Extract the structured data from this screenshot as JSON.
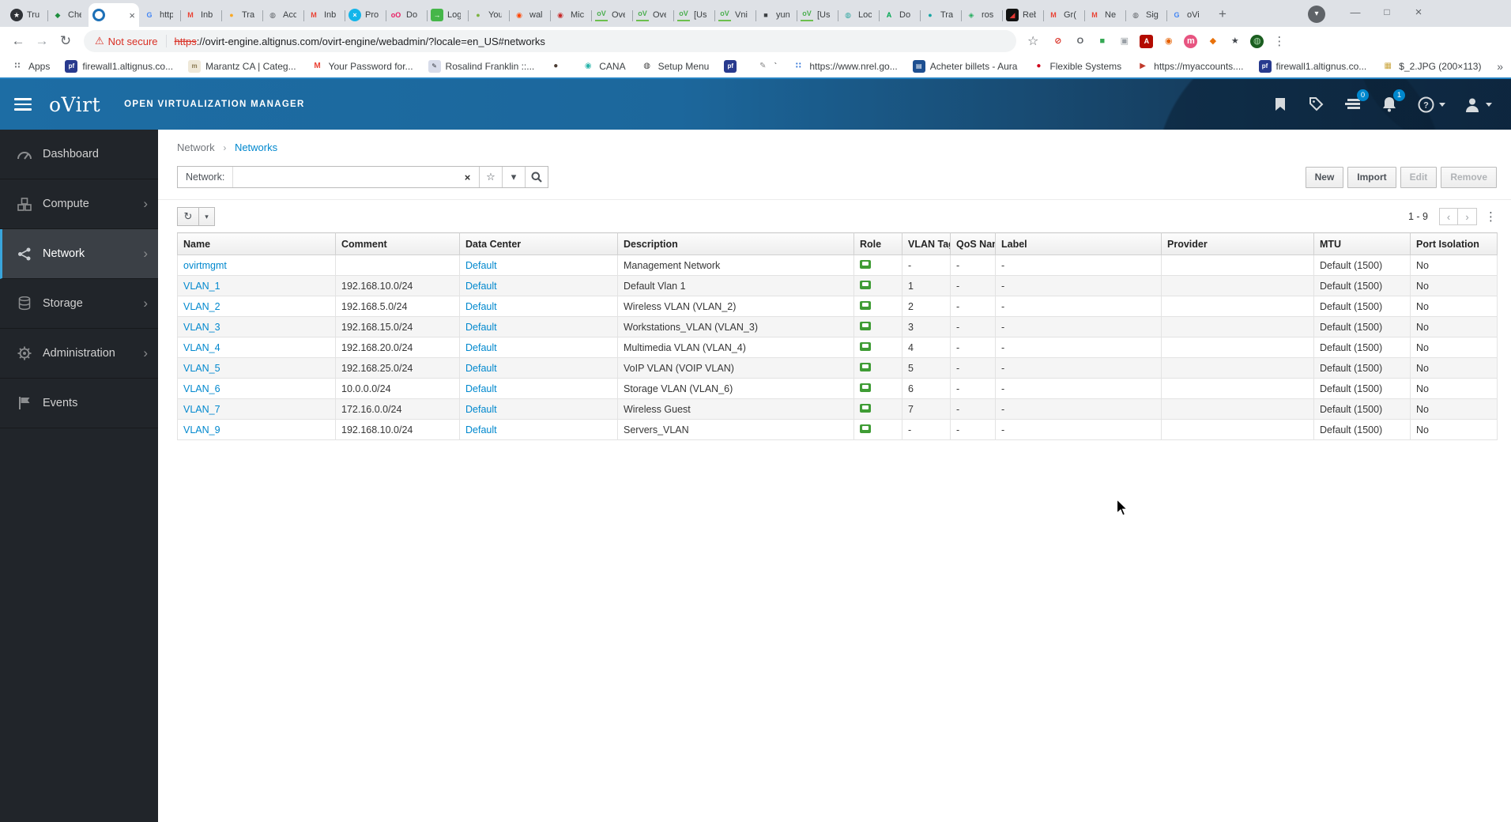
{
  "browser": {
    "tabs": [
      {
        "label": "Tru",
        "g": "★",
        "bg": "#2f3237",
        "fg": "#ffffff",
        "cls": "",
        "state": "",
        "close": ""
      },
      {
        "label": "Che",
        "g": "◆",
        "fg": "#1e8e3e",
        "cls": "",
        "state": "",
        "close": ""
      },
      {
        "label": "",
        "g": "",
        "cls": "ring",
        "state": "active",
        "close": "×"
      },
      {
        "label": "http",
        "g": "G",
        "fg": "#4285f4",
        "state": "",
        "close": ""
      },
      {
        "label": "Inb",
        "g": "M",
        "fg": "#ea4335",
        "state": "",
        "close": ""
      },
      {
        "label": "Tra",
        "g": "●",
        "fg": "#f9a825",
        "state": "",
        "close": ""
      },
      {
        "label": "Acc",
        "g": "◍",
        "fg": "#5f6368",
        "state": "",
        "close": ""
      },
      {
        "label": "Inb",
        "g": "M",
        "fg": "#ea4335",
        "state": "",
        "close": ""
      },
      {
        "label": "Pro",
        "g": "×",
        "bg": "#13b5ea",
        "fg": "#ffffff",
        "state": "",
        "close": ""
      },
      {
        "label": "Do",
        "g": "oO",
        "fg": "#e91e63",
        "state": "",
        "close": ""
      },
      {
        "label": "Log",
        "g": "→",
        "bg": "#45b649",
        "fg": "#ffffff",
        "cls": "sq",
        "state": "",
        "close": ""
      },
      {
        "label": "You",
        "g": "●",
        "fg": "#7cb342",
        "state": "",
        "close": ""
      },
      {
        "label": "wal",
        "g": "◉",
        "fg": "#ff4500",
        "state": "",
        "close": ""
      },
      {
        "label": "Mic",
        "g": "◉",
        "fg": "#c62828",
        "state": "",
        "close": ""
      },
      {
        "label": "Ove",
        "g": "oV",
        "cls": "ul",
        "fg": "#4caf50",
        "state": "",
        "close": ""
      },
      {
        "label": "Ove",
        "g": "oV",
        "cls": "ul",
        "fg": "#4caf50",
        "state": "",
        "close": ""
      },
      {
        "label": "[Us",
        "g": "oV",
        "cls": "ul",
        "fg": "#4caf50",
        "state": "",
        "close": ""
      },
      {
        "label": "Vni",
        "g": "oV",
        "cls": "ul",
        "fg": "#4caf50",
        "state": "",
        "close": ""
      },
      {
        "label": "yun",
        "g": "■",
        "fg": "#3c4043",
        "state": "",
        "close": ""
      },
      {
        "label": "[Us",
        "g": "oV",
        "cls": "ul",
        "fg": "#4caf50",
        "state": "",
        "close": ""
      },
      {
        "label": "Loc",
        "g": "◍",
        "fg": "#2fa7a0",
        "state": "",
        "close": ""
      },
      {
        "label": "Do",
        "g": "A",
        "fg": "#00a651",
        "state": "",
        "close": ""
      },
      {
        "label": "Tra",
        "g": "●",
        "fg": "#16a5a3",
        "state": "",
        "close": ""
      },
      {
        "label": "ros",
        "g": "◈",
        "fg": "#27ae60",
        "state": "",
        "close": ""
      },
      {
        "label": "Reb",
        "g": "◢",
        "bg": "#111111",
        "fg": "#e53935",
        "cls": "sq",
        "state": "",
        "close": ""
      },
      {
        "label": "Gr(",
        "g": "M",
        "fg": "#ea4335",
        "state": "",
        "close": ""
      },
      {
        "label": "Ne",
        "g": "M",
        "fg": "#ea4335",
        "state": "",
        "close": ""
      },
      {
        "label": "Sig",
        "g": "◍",
        "fg": "#5f6368",
        "state": "",
        "close": ""
      },
      {
        "label": "oVi",
        "g": "G",
        "fg": "#4285f4",
        "state": "",
        "close": ""
      }
    ],
    "new_tab_glyph": "+",
    "tab_search_glyph": "▾",
    "window_controls": {
      "minimize": "—",
      "maximize": "□",
      "close": "×"
    },
    "nav": {
      "back": "←",
      "forward": "→",
      "reload": "↻"
    },
    "address": {
      "warning_icon": "⚠",
      "warning_text": "Not secure",
      "scheme": "https",
      "rest": "://ovirt-engine.altignus.com/ovirt-engine/webadmin/?locale=en_US#networks"
    },
    "star_glyph": "☆",
    "menu_glyph": "⋮",
    "extensions": [
      {
        "g": "⊘",
        "fg": "#d93025"
      },
      {
        "g": "O",
        "fg": "#5f6368"
      },
      {
        "g": "■",
        "fg": "#34a853"
      },
      {
        "g": "▣",
        "fg": "#9aa0a6"
      },
      {
        "g": "A",
        "bg": "#b30b00",
        "fg": "#ffffff",
        "cls": "sq"
      },
      {
        "g": "◉",
        "fg": "#e66000"
      },
      {
        "g": "m",
        "bg": "#e75480",
        "fg": "#ffffff"
      },
      {
        "g": "◆",
        "fg": "#e8710a"
      },
      {
        "g": "★",
        "fg": "#41464c"
      },
      {
        "g": "◍",
        "bg": "#1b5e20",
        "fg": "#a5d6a7"
      }
    ],
    "bookmarks": [
      {
        "g": "∷",
        "fg": "#5f6368",
        "label": "Apps"
      },
      {
        "g": "pf",
        "bg": "#283a8e",
        "fg": "#ffffff",
        "cls": "sq",
        "label": "firewall1.altignus.co..."
      },
      {
        "g": "m",
        "bg": "#efe8d8",
        "fg": "#8a7a52",
        "cls": "sq",
        "label": "Marantz CA | Categ..."
      },
      {
        "g": "M",
        "fg": "#ea4335",
        "label": "Your Password for..."
      },
      {
        "g": "✎",
        "bg": "#d8dcea",
        "fg": "#30343b",
        "cls": "sq",
        "label": "Rosalind Franklin ::..."
      },
      {
        "g": "●",
        "fg": "#4a3b32",
        "label": ""
      },
      {
        "g": "◉",
        "fg": "#2ab5ab",
        "label": "CANA"
      },
      {
        "g": "◍",
        "fg": "#444444",
        "label": "Setup Menu"
      },
      {
        "g": "pf",
        "bg": "#283a8e",
        "fg": "#ffffff",
        "cls": "sq",
        "label": ""
      },
      {
        "g": "✎",
        "fg": "#888888",
        "label": "`"
      },
      {
        "g": "∷",
        "fg": "#2a6fd6",
        "label": "https://www.nrel.go..."
      },
      {
        "g": "▤",
        "bg": "#1d4f91",
        "fg": "#ffffff",
        "cls": "sq",
        "label": "Acheter billets - Aura"
      },
      {
        "g": "●",
        "fg": "#d0021b",
        "label": "Flexible Systems"
      },
      {
        "g": "▶",
        "fg": "#c0392b",
        "label": "https://myaccounts...."
      },
      {
        "g": "pf",
        "bg": "#283a8e",
        "fg": "#ffffff",
        "cls": "sq",
        "label": "firewall1.altignus.co..."
      },
      {
        "g": "▦",
        "fg": "#caa53d",
        "label": "$_2.JPG (200×113)"
      }
    ],
    "bookmarks_overflow_glyph": "»"
  },
  "masthead": {
    "brand": "oVirt",
    "product": "OPEN VIRTUALIZATION MANAGER",
    "tasks_badge": "0",
    "alerts_badge": "1"
  },
  "sidebar": {
    "items": [
      {
        "label": "Dashboard"
      },
      {
        "label": "Compute"
      },
      {
        "label": "Network"
      },
      {
        "label": "Storage"
      },
      {
        "label": "Administration"
      },
      {
        "label": "Events"
      }
    ]
  },
  "page": {
    "breadcrumb": {
      "section": "Network",
      "sep": "›",
      "current": "Networks"
    },
    "filter": {
      "label": "Network:",
      "value": "",
      "placeholder": "",
      "clear_glyph": "×",
      "star_glyph": "☆",
      "caret_glyph": "▾"
    },
    "actions": [
      {
        "label": "New",
        "state": ""
      },
      {
        "label": "Import",
        "state": ""
      },
      {
        "label": "Edit",
        "state": "disabled"
      },
      {
        "label": "Remove",
        "state": "disabled"
      }
    ],
    "toolbar": {
      "refresh_glyph": "↻",
      "caret_glyph": "▾",
      "count": "1 - 9",
      "prev_glyph": "‹",
      "next_glyph": "›",
      "kebab_glyph": "⋮"
    },
    "table": {
      "columns": [
        "Name",
        "Comment",
        "Data Center",
        "Description",
        "Role",
        "VLAN Tag",
        "QoS Name",
        "Label",
        "Provider",
        "MTU",
        "Port Isolation"
      ],
      "rows": [
        {
          "name": "ovirtmgmt",
          "comment": "",
          "dc": "Default",
          "desc": "Management Network",
          "vlan": "-",
          "qos": "-",
          "label": "-",
          "provider": "",
          "mtu": "Default (1500)",
          "isolation": "No"
        },
        {
          "name": "VLAN_1",
          "comment": "192.168.10.0/24",
          "dc": "Default",
          "desc": "Default Vlan 1",
          "vlan": "1",
          "qos": "-",
          "label": "-",
          "provider": "",
          "mtu": "Default (1500)",
          "isolation": "No"
        },
        {
          "name": "VLAN_2",
          "comment": "192.168.5.0/24",
          "dc": "Default",
          "desc": "Wireless VLAN (VLAN_2)",
          "vlan": "2",
          "qos": "-",
          "label": "-",
          "provider": "",
          "mtu": "Default (1500)",
          "isolation": "No"
        },
        {
          "name": "VLAN_3",
          "comment": "192.168.15.0/24",
          "dc": "Default",
          "desc": "Workstations_VLAN (VLAN_3)",
          "vlan": "3",
          "qos": "-",
          "label": "-",
          "provider": "",
          "mtu": "Default (1500)",
          "isolation": "No"
        },
        {
          "name": "VLAN_4",
          "comment": "192.168.20.0/24",
          "dc": "Default",
          "desc": "Multimedia VLAN (VLAN_4)",
          "vlan": "4",
          "qos": "-",
          "label": "-",
          "provider": "",
          "mtu": "Default (1500)",
          "isolation": "No"
        },
        {
          "name": "VLAN_5",
          "comment": "192.168.25.0/24",
          "dc": "Default",
          "desc": "VoIP VLAN (VOIP VLAN)",
          "vlan": "5",
          "qos": "-",
          "label": "-",
          "provider": "",
          "mtu": "Default (1500)",
          "isolation": "No"
        },
        {
          "name": "VLAN_6",
          "comment": "10.0.0.0/24",
          "dc": "Default",
          "desc": "Storage VLAN (VLAN_6)",
          "vlan": "6",
          "qos": "-",
          "label": "-",
          "provider": "",
          "mtu": "Default (1500)",
          "isolation": "No"
        },
        {
          "name": "VLAN_7",
          "comment": "172.16.0.0/24",
          "dc": "Default",
          "desc": "Wireless Guest",
          "vlan": "7",
          "qos": "-",
          "label": "-",
          "provider": "",
          "mtu": "Default (1500)",
          "isolation": "No"
        },
        {
          "name": "VLAN_9",
          "comment": "192.168.10.0/24",
          "dc": "Default",
          "desc": "Servers_VLAN",
          "vlan": "-",
          "qos": "-",
          "label": "-",
          "provider": "",
          "mtu": "Default (1500)",
          "isolation": "No"
        }
      ]
    }
  }
}
